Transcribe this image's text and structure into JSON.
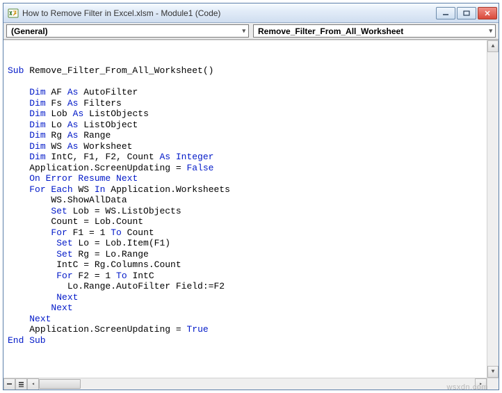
{
  "window": {
    "title": "How to Remove Filter in Excel.xlsm - Module1 (Code)"
  },
  "dropdowns": {
    "left": "(General)",
    "right": "Remove_Filter_From_All_Worksheet"
  },
  "code": {
    "line1_a": "Sub",
    "line1_b": " Remove_Filter_From_All_Worksheet()",
    "line2": "",
    "line3_a": "Dim",
    "line3_b": " AF ",
    "line3_c": "As",
    "line3_d": " AutoFilter",
    "line4_a": "Dim",
    "line4_b": " Fs ",
    "line4_c": "As",
    "line4_d": " Filters",
    "line5_a": "Dim",
    "line5_b": " Lob ",
    "line5_c": "As",
    "line5_d": " ListObjects",
    "line6_a": "Dim",
    "line6_b": " Lo ",
    "line6_c": "As",
    "line6_d": " ListObject",
    "line7_a": "Dim",
    "line7_b": " Rg ",
    "line7_c": "As",
    "line7_d": " Range",
    "line8_a": "Dim",
    "line8_b": " WS ",
    "line8_c": "As",
    "line8_d": " Worksheet",
    "line9_a": "Dim",
    "line9_b": " IntC, F1, F2, Count ",
    "line9_c": "As Integer",
    "line10_a": "Application.ScreenUpdating = ",
    "line10_b": "False",
    "line11": "On Error Resume Next",
    "line12_a": "For Each",
    "line12_b": " WS ",
    "line12_c": "In",
    "line12_d": " Application.Worksheets",
    "line13": "WS.ShowAllData",
    "line14_a": "Set",
    "line14_b": " Lob = WS.ListObjects",
    "line15": "Count = Lob.Count",
    "line16_a": "For",
    "line16_b": " F1 = 1 ",
    "line16_c": "To",
    "line16_d": " Count",
    "line17_a": "Set",
    "line17_b": " Lo = Lob.Item(F1)",
    "line18_a": "Set",
    "line18_b": " Rg = Lo.Range",
    "line19": "IntC = Rg.Columns.Count",
    "line20_a": "For",
    "line20_b": " F2 = 1 ",
    "line20_c": "To",
    "line20_d": " IntC",
    "line21": "Lo.Range.AutoFilter Field:=F2",
    "line22": "Next",
    "line23": "Next",
    "line24": "Next",
    "line25_a": "Application.ScreenUpdating = ",
    "line25_b": "True",
    "line26": "End Sub"
  },
  "watermark": "wsxdn.com"
}
